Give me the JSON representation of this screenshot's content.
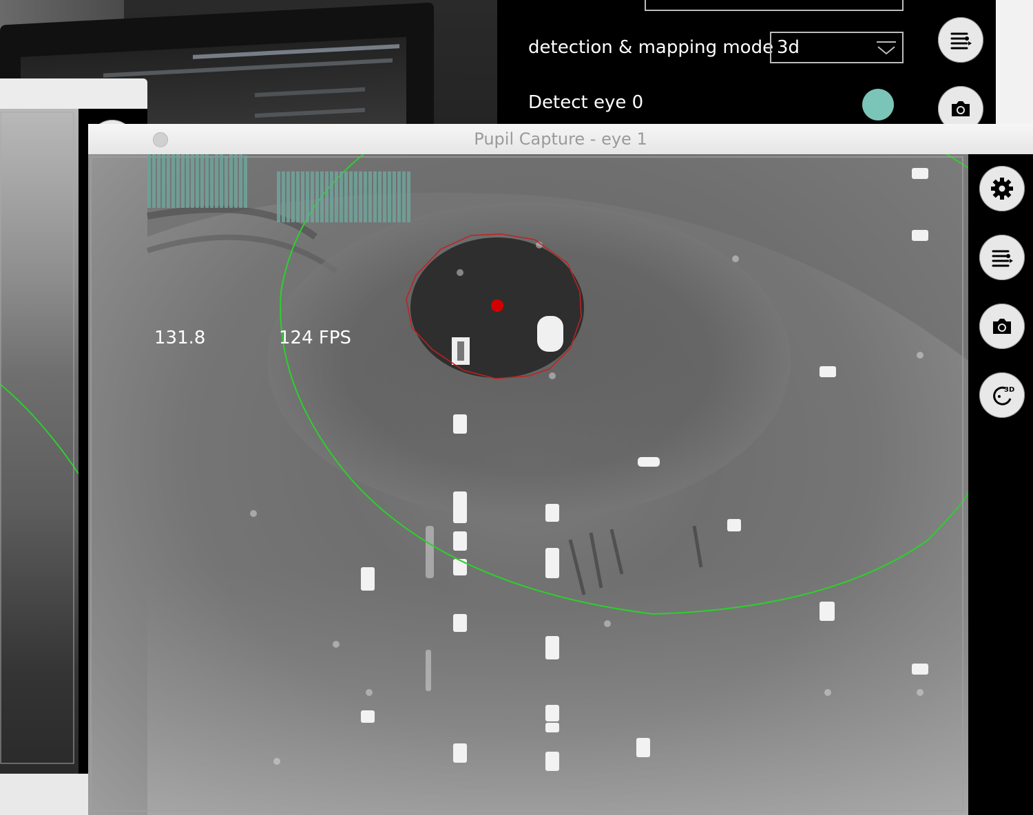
{
  "main_window": {
    "settings": [
      {
        "label": "detection & mapping mode",
        "value": "3d"
      },
      {
        "label": "Detect eye 0"
      }
    ],
    "toggle_color": "#7bc4b8",
    "sidebar_icons": [
      "menu-list-icon",
      "camera-icon"
    ]
  },
  "eye0_window": {
    "sidebar_icons": [
      "gear-icon",
      "menu-list-icon",
      "camera-icon",
      "3d-reset-icon"
    ],
    "icon_3d_text": "3D"
  },
  "eye1_window": {
    "title": "Pupil Capture - eye 1",
    "graphs": [
      {
        "label": "131.8"
      },
      {
        "label": "124 FPS"
      }
    ],
    "graph_color": "#6ea59b",
    "pupil_ellipse_color": "#c42020",
    "pupil_center_color": "#d40000",
    "eye_model_color": "#2bd12b",
    "sidebar_icons": [
      "gear-icon",
      "menu-list-icon",
      "camera-icon",
      "3d-reset-icon"
    ],
    "icon_3d_text": "3D"
  }
}
